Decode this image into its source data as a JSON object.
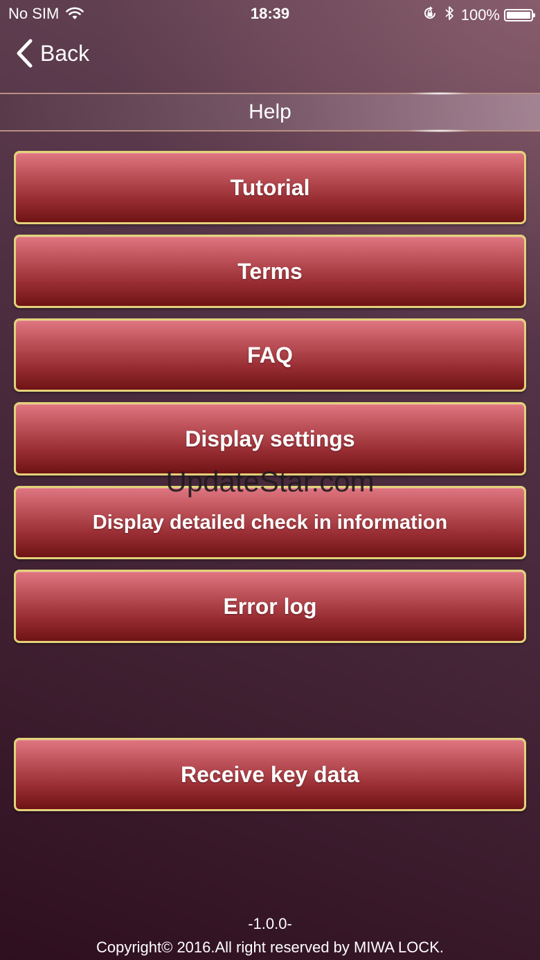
{
  "status_bar": {
    "carrier": "No SIM",
    "time": "18:39",
    "battery": "100%"
  },
  "nav": {
    "back_label": "Back",
    "title": "Help"
  },
  "menu": {
    "items": [
      {
        "label": "Tutorial"
      },
      {
        "label": "Terms"
      },
      {
        "label": "FAQ"
      },
      {
        "label": "Display settings"
      },
      {
        "label": "Display detailed check in information"
      },
      {
        "label": "Error log"
      }
    ],
    "receive_key_data": "Receive key data"
  },
  "watermark": "UpdateStar.com",
  "footer": {
    "version": "-1.0.0-",
    "copyright": "Copyright© 2016.All right reserved by MIWA LOCK."
  },
  "colors": {
    "button_border": "#e3d27a",
    "button_top": "#df7680",
    "button_bottom": "#6f1315",
    "background_dark": "#2e0f1f"
  }
}
